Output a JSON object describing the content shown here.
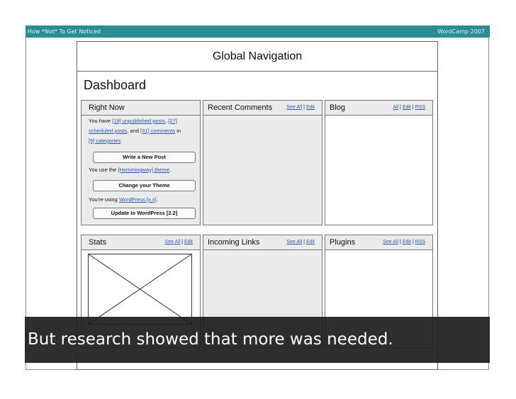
{
  "slide": {
    "left_title": "How *Not* To Get Noticed",
    "right_title": "WordCamp 2007",
    "caption": "But research showed that more was needed."
  },
  "wireframe": {
    "global_nav": "Global Navigation",
    "dashboard_title": "Dashboard",
    "right_now": {
      "title": "Right Now",
      "line1_prefix": "You have ",
      "unpublished": "[19] unpublished posts",
      "comma": ", ",
      "scheduled_a": "[27]",
      "scheduled_b": "scheduled posts",
      "and": ", and ",
      "comments": "[31] comments",
      "in": " in",
      "categories": "[9] categories",
      "period": ".",
      "btn_write": "Write a New Post",
      "theme_prefix": "You use the ",
      "theme": "[Hemmingway] theme",
      "theme_suffix": ".",
      "btn_theme": "Change your Theme",
      "wp_prefix": "You're using ",
      "wp": "WordPress [x.x]",
      "wp_suffix": ".",
      "btn_update": "Update to WordPress [2.2]"
    },
    "recent_comments": {
      "title": "Recent Comments",
      "see_all": "See All",
      "sep": " | ",
      "edit": "Edit"
    },
    "blog": {
      "title": "Blog",
      "all": "All",
      "sep1": " | ",
      "edit": "Edit",
      "sep2": " | ",
      "rss": "RSS"
    },
    "stats": {
      "title": "Stats",
      "see_all": "See All",
      "sep": " | ",
      "edit": "Edit"
    },
    "incoming_links": {
      "title": "Incoming Links",
      "see_all": "See All",
      "sep": " | ",
      "edit": "Edit"
    },
    "plugins": {
      "title": "Plugins",
      "see_all": "See All",
      "sep1": " | ",
      "edit": "Edit",
      "sep2": " | ",
      "rss": "RSS"
    }
  },
  "colors": {
    "title_bar": "#2a8d96",
    "caption_bg": "#1e1e1e",
    "panel_bg": "#ebebeb",
    "link": "#2a5aa8"
  }
}
